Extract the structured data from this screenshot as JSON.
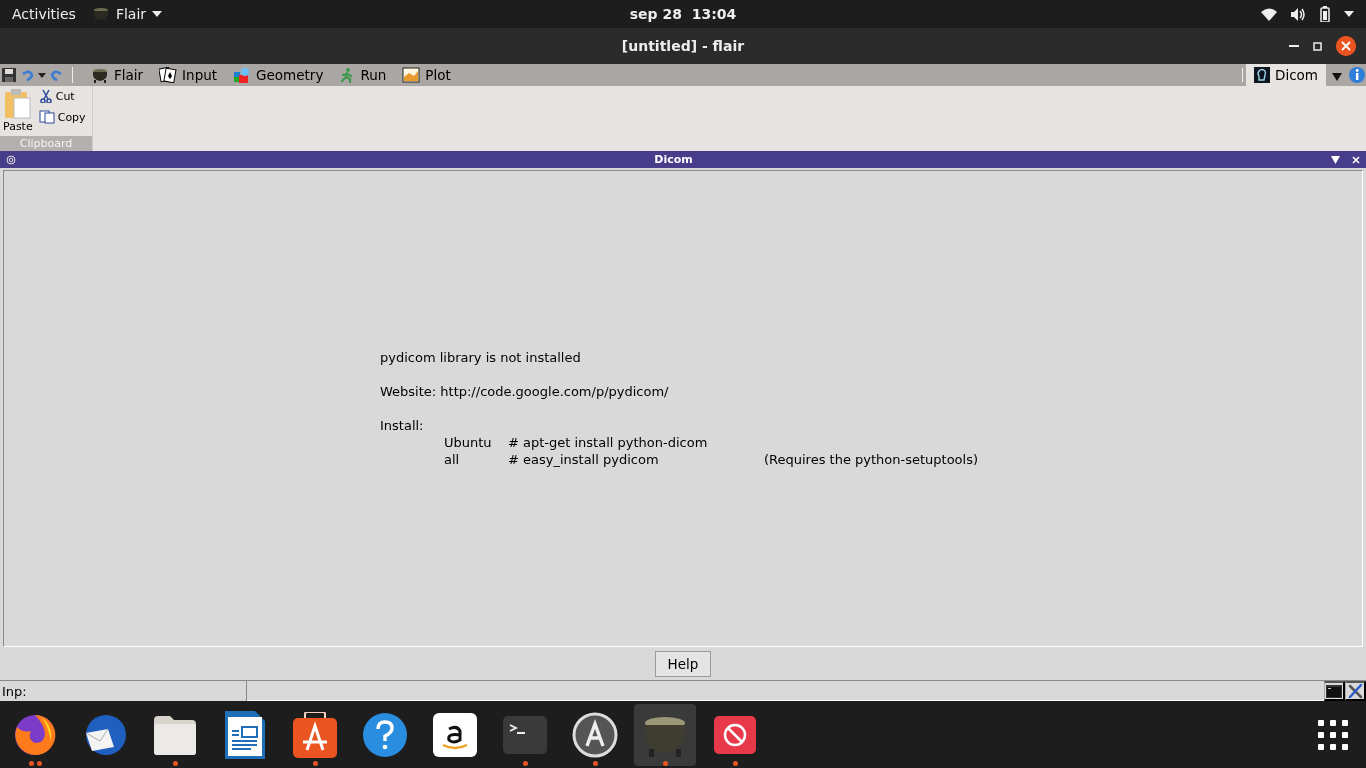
{
  "top_bar": {
    "activities": "Activities",
    "app_menu": "Flair",
    "clock": "sep 28  13:04"
  },
  "window": {
    "title": "[untitled] - flair"
  },
  "ribbon": {
    "tabs": [
      {
        "label": "Flair",
        "kind": "cauldron",
        "selected": false
      },
      {
        "label": "Input",
        "kind": "cards",
        "selected": false
      },
      {
        "label": "Geometry",
        "kind": "shapes",
        "selected": false
      },
      {
        "label": "Run",
        "kind": "runner",
        "selected": false
      },
      {
        "label": "Plot",
        "kind": "plot",
        "selected": false
      },
      {
        "label": "Dicom",
        "kind": "scan",
        "selected": true
      }
    ],
    "clipboard": {
      "paste": "Paste",
      "cut": "Cut",
      "copy": "Copy",
      "group_label": "Clipboard"
    }
  },
  "panel": {
    "title": "Dicom",
    "message": "pydicom library is not installed",
    "website": "Website: http://code.google.com/p/pydicom/",
    "install_label": "Install:",
    "install_rows": [
      {
        "system": "Ubuntu",
        "command": "# apt-get install python-dicom"
      },
      {
        "system": "all",
        "command": "# easy_install pydicom",
        "note": "(Requires the python-setuptools)"
      }
    ],
    "help_button": "Help"
  },
  "status_bar": {
    "field_1": "Inp:"
  },
  "dock": {
    "items": [
      {
        "kind": "browser",
        "running": true,
        "multiple_windows": true,
        "selected": false
      },
      {
        "kind": "mail",
        "running": false,
        "multiple_windows": false,
        "selected": false
      },
      {
        "kind": "folder",
        "running": true,
        "multiple_windows": false,
        "selected": false
      },
      {
        "kind": "document",
        "running": false,
        "multiple_windows": false,
        "selected": false
      },
      {
        "kind": "store",
        "running": true,
        "multiple_windows": false,
        "selected": false
      },
      {
        "kind": "help",
        "running": false,
        "multiple_windows": false,
        "selected": false
      },
      {
        "kind": "shop",
        "running": false,
        "multiple_windows": false,
        "selected": false
      },
      {
        "kind": "terminal",
        "running": true,
        "multiple_windows": false,
        "selected": false
      },
      {
        "kind": "updater",
        "running": true,
        "multiple_windows": false,
        "selected": false
      },
      {
        "kind": "cauldron",
        "running": true,
        "multiple_windows": false,
        "selected": true
      },
      {
        "kind": "blocked",
        "running": true,
        "multiple_windows": false,
        "selected": false
      }
    ]
  }
}
